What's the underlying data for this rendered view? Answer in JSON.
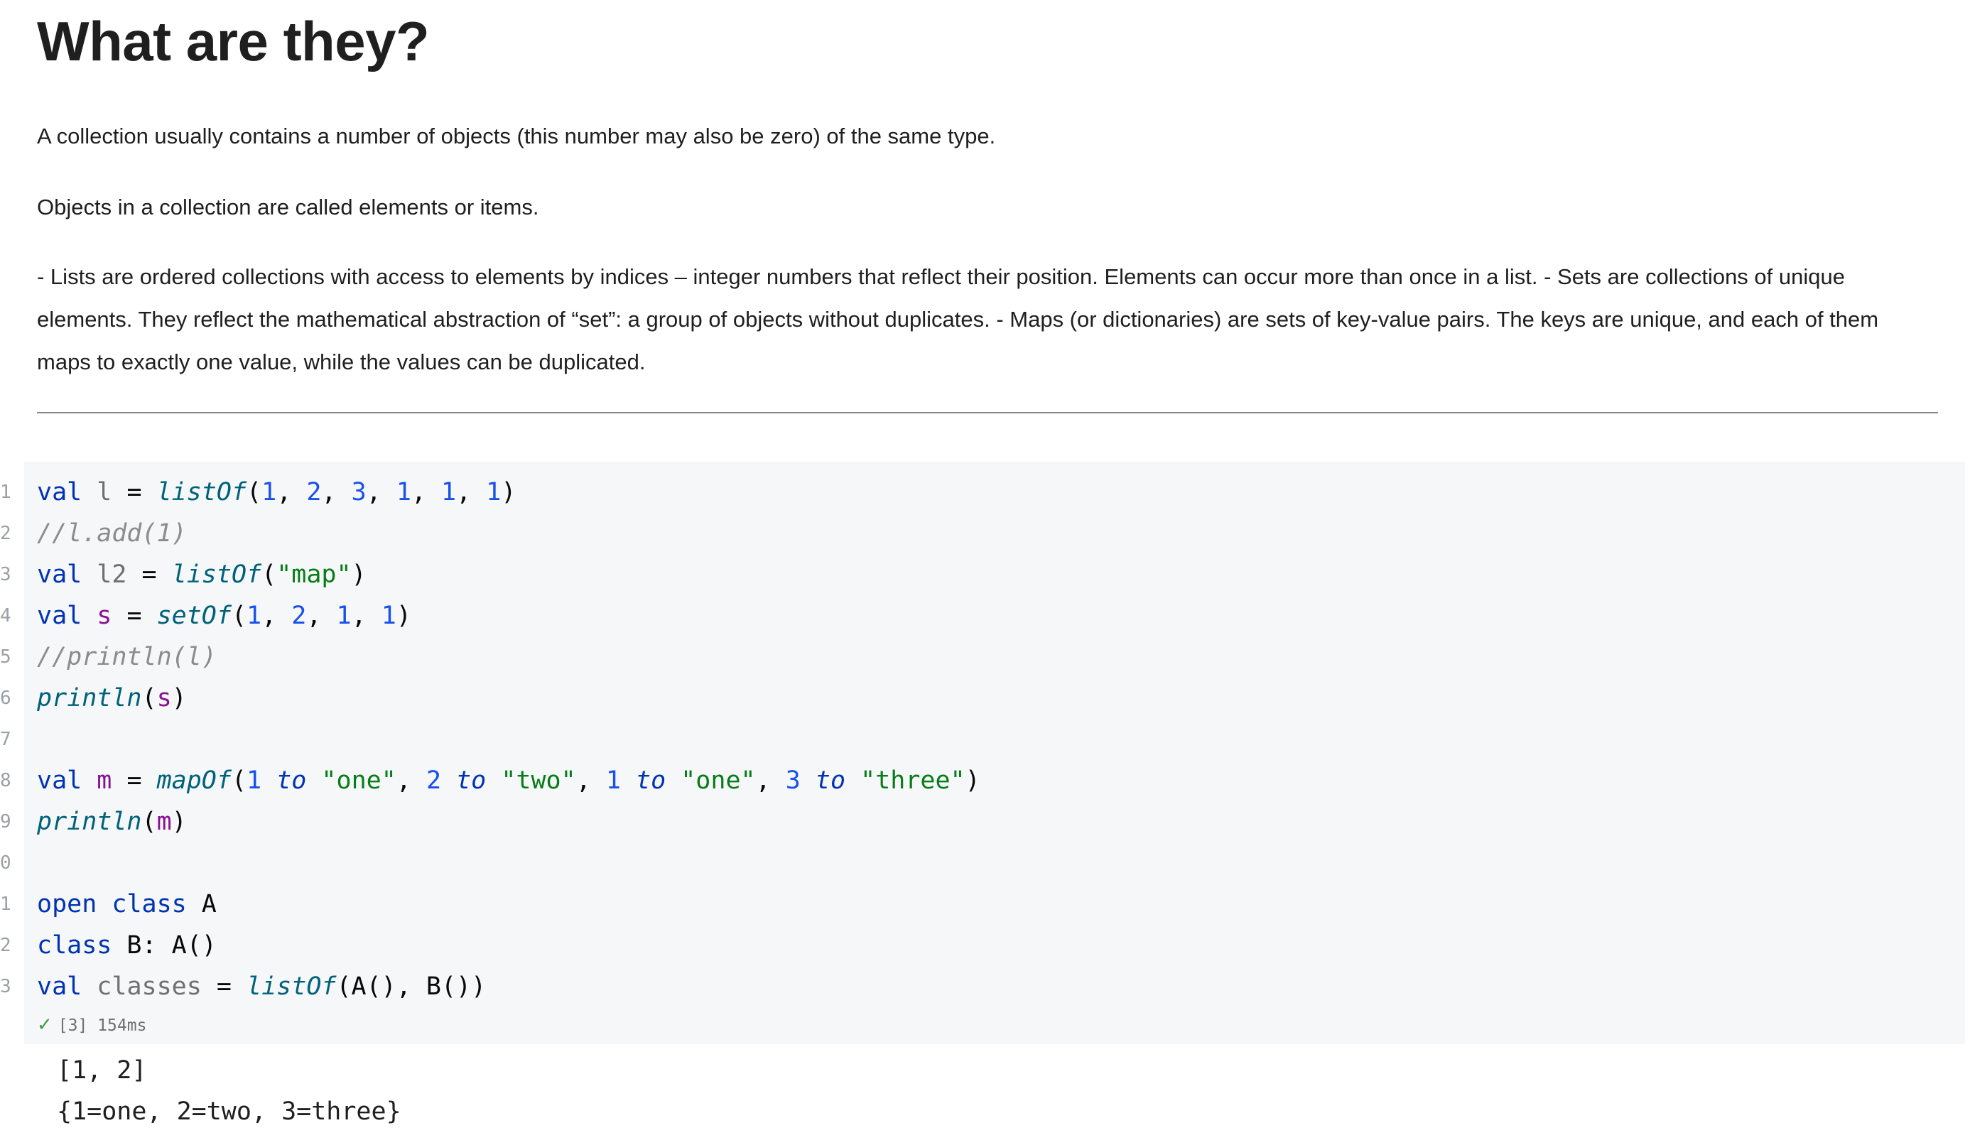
{
  "markdown": {
    "heading": "What are they?",
    "paragraphs": [
      "A collection usually contains a number of objects (this number may also be zero) of the same type.",
      "Objects in a collection are called elements or items.",
      "- Lists are ordered collections with access to elements by indices – integer numbers that reflect their position. Elements can occur more than once in a list. - Sets are collections of unique elements. They reflect the mathematical abstraction of “set”: a group of objects without duplicates. - Maps (or dictionaries) are sets of key-value pairs. The keys are unique, and each of them maps to exactly one value, while the values can be duplicated."
    ]
  },
  "code_cell": {
    "line_numbers": [
      "1",
      "2",
      "3",
      "4",
      "5",
      "6",
      "7",
      "8",
      "9",
      "0",
      "1",
      "2",
      "3"
    ],
    "status": {
      "check_icon": "check-icon",
      "text": "[3] 154ms"
    },
    "output_lines": [
      "[1, 2]",
      "{1=one, 2=two, 3=three}"
    ]
  },
  "colors": {
    "keyword": "#0033b3",
    "number": "#1750eb",
    "string": "#067d17",
    "function": "#00627a",
    "comment": "#8c8c8c",
    "local_var": "#871094",
    "cell_background": "#f6f7f9"
  },
  "code_tokens": [
    [
      [
        "kw",
        "val"
      ],
      [
        "plain",
        " "
      ],
      [
        "var",
        "l"
      ],
      [
        "plain",
        " = "
      ],
      [
        "fn",
        "listOf"
      ],
      [
        "plain",
        "("
      ],
      [
        "num",
        "1"
      ],
      [
        "plain",
        ", "
      ],
      [
        "num",
        "2"
      ],
      [
        "plain",
        ", "
      ],
      [
        "num",
        "3"
      ],
      [
        "plain",
        ", "
      ],
      [
        "num",
        "1"
      ],
      [
        "plain",
        ", "
      ],
      [
        "num",
        "1"
      ],
      [
        "plain",
        ", "
      ],
      [
        "num",
        "1"
      ],
      [
        "plain",
        ")"
      ]
    ],
    [
      [
        "cmt",
        "//l.add(1)"
      ]
    ],
    [
      [
        "kw",
        "val"
      ],
      [
        "plain",
        " "
      ],
      [
        "var",
        "l2"
      ],
      [
        "plain",
        " = "
      ],
      [
        "fn",
        "listOf"
      ],
      [
        "plain",
        "("
      ],
      [
        "str",
        "\"map\""
      ],
      [
        "plain",
        ")"
      ]
    ],
    [
      [
        "kw",
        "val"
      ],
      [
        "plain",
        " "
      ],
      [
        "lvar",
        "s"
      ],
      [
        "plain",
        " = "
      ],
      [
        "fn",
        "setOf"
      ],
      [
        "plain",
        "("
      ],
      [
        "num",
        "1"
      ],
      [
        "plain",
        ", "
      ],
      [
        "num",
        "2"
      ],
      [
        "plain",
        ", "
      ],
      [
        "num",
        "1"
      ],
      [
        "plain",
        ", "
      ],
      [
        "num",
        "1"
      ],
      [
        "plain",
        ")"
      ]
    ],
    [
      [
        "cmt",
        "//println(l)"
      ]
    ],
    [
      [
        "fn",
        "println"
      ],
      [
        "plain",
        "("
      ],
      [
        "lvar",
        "s"
      ],
      [
        "plain",
        ")"
      ]
    ],
    [],
    [
      [
        "kw",
        "val"
      ],
      [
        "plain",
        " "
      ],
      [
        "lvar",
        "m"
      ],
      [
        "plain",
        " = "
      ],
      [
        "fn",
        "mapOf"
      ],
      [
        "plain",
        "("
      ],
      [
        "num",
        "1"
      ],
      [
        "plain",
        " "
      ],
      [
        "inf",
        "to"
      ],
      [
        "plain",
        " "
      ],
      [
        "str",
        "\"one\""
      ],
      [
        "plain",
        ", "
      ],
      [
        "num",
        "2"
      ],
      [
        "plain",
        " "
      ],
      [
        "inf",
        "to"
      ],
      [
        "plain",
        " "
      ],
      [
        "str",
        "\"two\""
      ],
      [
        "plain",
        ", "
      ],
      [
        "num",
        "1"
      ],
      [
        "plain",
        " "
      ],
      [
        "inf",
        "to"
      ],
      [
        "plain",
        " "
      ],
      [
        "str",
        "\"one\""
      ],
      [
        "plain",
        ", "
      ],
      [
        "num",
        "3"
      ],
      [
        "plain",
        " "
      ],
      [
        "inf",
        "to"
      ],
      [
        "plain",
        " "
      ],
      [
        "str",
        "\"three\""
      ],
      [
        "plain",
        ")"
      ]
    ],
    [
      [
        "fn",
        "println"
      ],
      [
        "plain",
        "("
      ],
      [
        "lvar",
        "m"
      ],
      [
        "plain",
        ")"
      ]
    ],
    [],
    [
      [
        "kw",
        "open"
      ],
      [
        "plain",
        " "
      ],
      [
        "kw",
        "class"
      ],
      [
        "plain",
        " A"
      ]
    ],
    [
      [
        "kw",
        "class"
      ],
      [
        "plain",
        " B: A()"
      ]
    ],
    [
      [
        "kw",
        "val"
      ],
      [
        "plain",
        " "
      ],
      [
        "var",
        "classes"
      ],
      [
        "plain",
        " = "
      ],
      [
        "fn",
        "listOf"
      ],
      [
        "plain",
        "(A(), B())"
      ]
    ]
  ]
}
